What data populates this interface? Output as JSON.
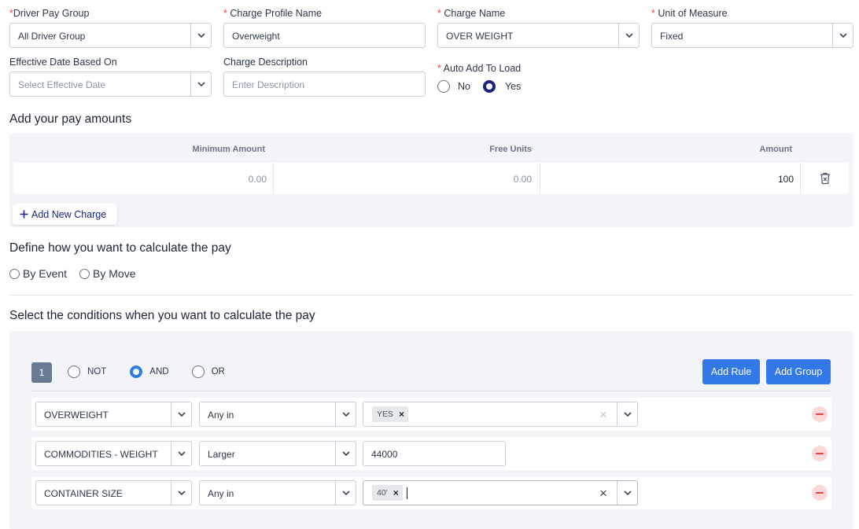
{
  "form": {
    "driver_pay_group": {
      "label": "Driver Pay Group",
      "value": "All Driver Group"
    },
    "charge_profile_name": {
      "label": "Charge Profile Name",
      "value": "Overweight"
    },
    "charge_name": {
      "label": "Charge Name",
      "value": "OVER WEIGHT"
    },
    "unit_of_measure": {
      "label": "Unit of Measure",
      "value": "Fixed"
    },
    "effective_date": {
      "label": "Effective Date Based On",
      "placeholder": "Select Effective Date"
    },
    "charge_description": {
      "label": "Charge Description",
      "placeholder": "Enter Description"
    },
    "auto_add": {
      "label": "Auto Add To Load",
      "options": [
        "No",
        "Yes"
      ],
      "selected": "Yes"
    }
  },
  "pay_amounts": {
    "title": "Add your pay amounts",
    "columns": [
      "Minimum Amount",
      "Free Units",
      "Amount"
    ],
    "rows": [
      {
        "minimum": "0.00",
        "free_units": "0.00",
        "amount": "100"
      }
    ],
    "add_button": "Add New Charge"
  },
  "calculate": {
    "title": "Define how you want to calculate the pay",
    "options": [
      "By Event",
      "By Move"
    ]
  },
  "conditions": {
    "title": "Select the conditions when you want to calculate the pay",
    "group_number": "1",
    "operators": [
      "NOT",
      "AND",
      "OR"
    ],
    "selected_operator": "AND",
    "add_rule": "Add Rule",
    "add_group": "Add Group",
    "rules": [
      {
        "field": "OVERWEIGHT",
        "operator": "Any in",
        "tags": [
          "YES"
        ]
      },
      {
        "field": "COMMODITIES - WEIGHT",
        "operator": "Larger",
        "value": "44000"
      },
      {
        "field": "CONTAINER SIZE",
        "operator": "Any in",
        "tags": [
          "40'"
        ]
      }
    ]
  },
  "icons": {
    "caret": "chevron-down-icon",
    "delete": "trash-icon",
    "add": "plus-icon",
    "clear": "close-icon",
    "remove_rule": "minus-circle-icon"
  },
  "colors": {
    "primary_button": "#3378e8",
    "radio_selected_navy": "#1a237e",
    "required_asterisk": "#e04646",
    "remove_icon_bg": "#fbd9d9",
    "panel_bg": "#f2f4f7"
  }
}
